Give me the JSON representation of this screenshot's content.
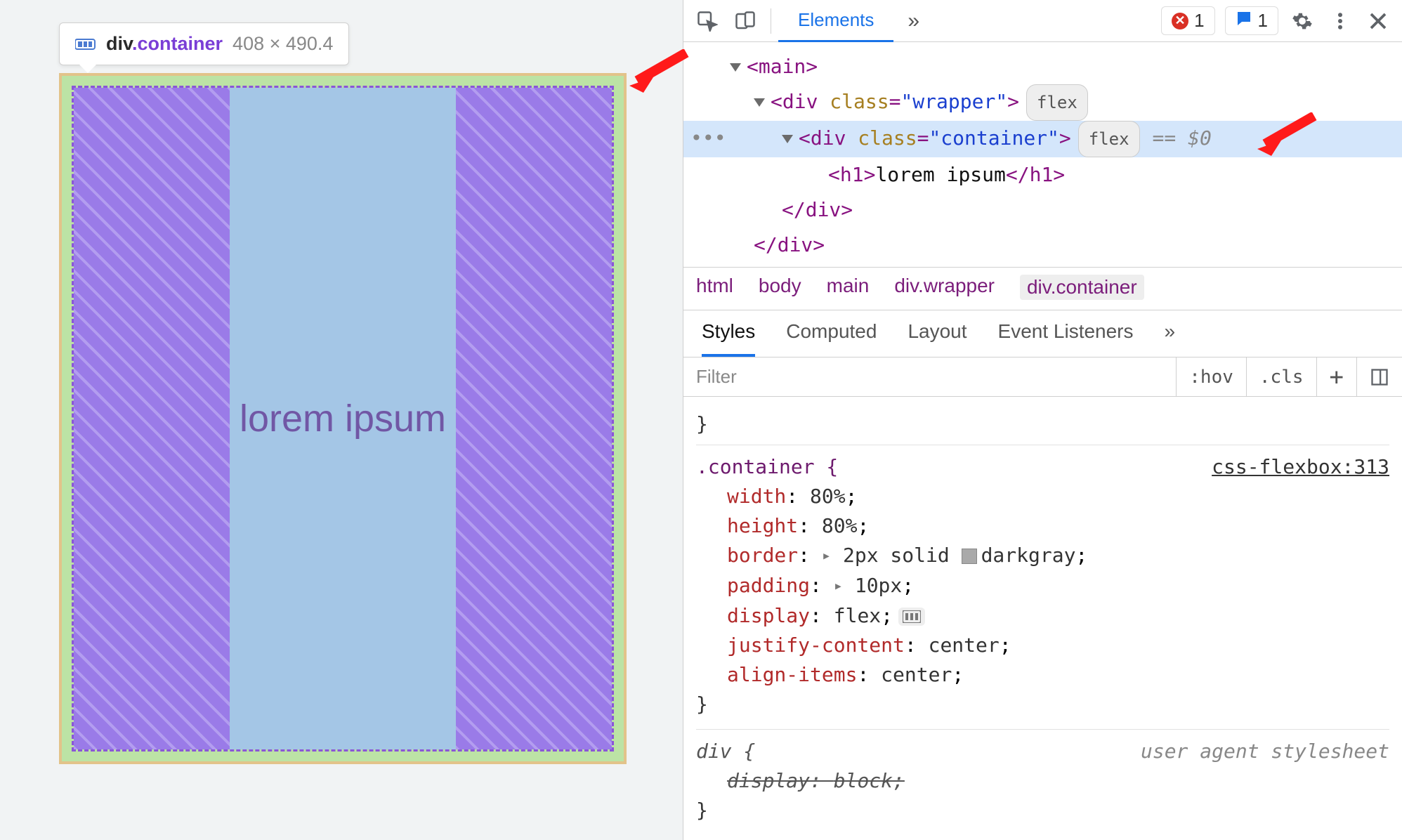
{
  "tooltip": {
    "tag": "div",
    "cls": ".container",
    "dims": "408 × 490.4"
  },
  "preview": {
    "text": "lorem ipsum"
  },
  "toolbar": {
    "tab_elements": "Elements",
    "more": "»",
    "error_count": "1",
    "msg_count": "1"
  },
  "dom": {
    "l0_open": "<main>",
    "l1_open_a": "<div ",
    "l1_attr": "class",
    "l1_val": "\"wrapper\"",
    "l1_open_b": ">",
    "l1_pill": "flex",
    "l2_open_a": "<div ",
    "l2_attr": "class",
    "l2_val": "\"container\"",
    "l2_open_b": ">",
    "l2_pill": "flex",
    "l2_suffix": "== $0",
    "l3_open": "<h1>",
    "l3_text": "lorem ipsum",
    "l3_close": "</h1>",
    "l2_close": "</div>",
    "l1_close": "</div>"
  },
  "crumbs": [
    "html",
    "body",
    "main",
    "div.wrapper",
    "div.container"
  ],
  "styles_tabs": {
    "styles": "Styles",
    "computed": "Computed",
    "layout": "Layout",
    "listeners": "Event Listeners",
    "more": "»"
  },
  "filter": {
    "placeholder": "Filter",
    "hov": ":hov",
    "cls": ".cls",
    "plus": "+"
  },
  "rules": {
    "r1": {
      "selector": ".container {",
      "source": "css-flexbox:313",
      "d1_p": "width",
      "d1_v": "80%",
      "d2_p": "height",
      "d2_v": "80%",
      "d3_p": "border",
      "d3_v_a": "2px solid ",
      "d3_v_b": "darkgray",
      "d4_p": "padding",
      "d4_v": "10px",
      "d5_p": "display",
      "d5_v": "flex",
      "d6_p": "justify-content",
      "d6_v": "center",
      "d7_p": "align-items",
      "d7_v": "center",
      "close": "}"
    },
    "r2": {
      "selector": "div {",
      "source": "user agent stylesheet",
      "d1_p": "display",
      "d1_v": "block",
      "close": "}"
    }
  }
}
